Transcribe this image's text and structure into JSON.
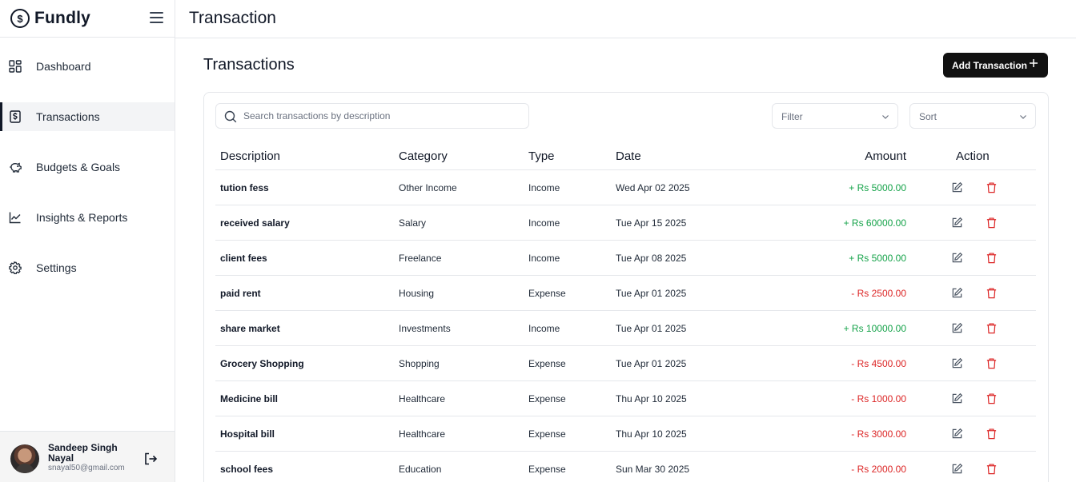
{
  "app": {
    "name": "Fundly",
    "logo_glyph": "$"
  },
  "sidebar": {
    "items": [
      {
        "label": "Dashboard",
        "icon": "dashboard-grid-icon",
        "active": false
      },
      {
        "label": "Transactions",
        "icon": "receipt-dollar-icon",
        "active": true
      },
      {
        "label": "Budgets & Goals",
        "icon": "piggy-bank-icon",
        "active": false
      },
      {
        "label": "Insights & Reports",
        "icon": "line-chart-icon",
        "active": false
      },
      {
        "label": "Settings",
        "icon": "gear-icon",
        "active": false
      }
    ]
  },
  "user": {
    "name": "Sandeep Singh Nayal",
    "email": "snayal50@gmail.com"
  },
  "header": {
    "title": "Transaction"
  },
  "main": {
    "heading": "Transactions",
    "add_button_label": "Add Transaction",
    "search_placeholder": "Search transactions by description",
    "filter_label": "Filter",
    "sort_label": "Sort"
  },
  "table": {
    "columns": {
      "description": "Description",
      "category": "Category",
      "type": "Type",
      "date": "Date",
      "amount": "Amount",
      "action": "Action"
    },
    "rows": [
      {
        "description": "tution fess",
        "category": "Other Income",
        "type": "Income",
        "date": "Wed Apr 02 2025",
        "amount": "+ Rs 5000.00"
      },
      {
        "description": "received salary",
        "category": "Salary",
        "type": "Income",
        "date": "Tue Apr 15 2025",
        "amount": "+ Rs 60000.00"
      },
      {
        "description": "client fees",
        "category": "Freelance",
        "type": "Income",
        "date": "Tue Apr 08 2025",
        "amount": "+ Rs 5000.00"
      },
      {
        "description": "paid rent",
        "category": "Housing",
        "type": "Expense",
        "date": "Tue Apr 01 2025",
        "amount": "- Rs 2500.00"
      },
      {
        "description": "share market",
        "category": "Investments",
        "type": "Income",
        "date": "Tue Apr 01 2025",
        "amount": "+ Rs 10000.00"
      },
      {
        "description": "Grocery Shopping",
        "category": "Shopping",
        "type": "Expense",
        "date": "Tue Apr 01 2025",
        "amount": "- Rs 4500.00"
      },
      {
        "description": "Medicine bill",
        "category": "Healthcare",
        "type": "Expense",
        "date": "Thu Apr 10 2025",
        "amount": "- Rs 1000.00"
      },
      {
        "description": "Hospital bill",
        "category": "Healthcare",
        "type": "Expense",
        "date": "Thu Apr 10 2025",
        "amount": "- Rs 3000.00"
      },
      {
        "description": "school fees",
        "category": "Education",
        "type": "Expense",
        "date": "Sun Mar 30 2025",
        "amount": "- Rs 2000.00"
      }
    ]
  },
  "colors": {
    "income": "#16a34a",
    "expense": "#dc2626",
    "primary_button": "#111111"
  }
}
